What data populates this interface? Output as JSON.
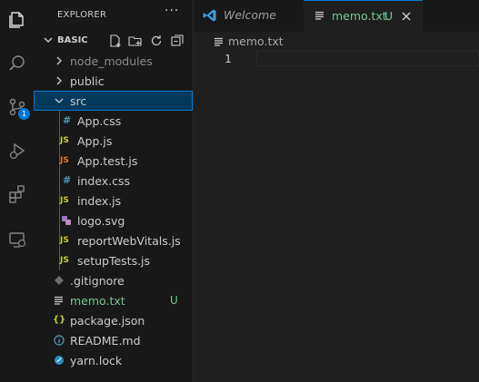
{
  "sidebar": {
    "title": "EXPLORER",
    "more_label": "···",
    "section": "BASIC",
    "items": [
      {
        "label": "node_modules"
      },
      {
        "label": "public"
      },
      {
        "label": "src"
      },
      {
        "label": "App.css",
        "icon": "#"
      },
      {
        "label": "App.js",
        "icon": "JS"
      },
      {
        "label": "App.test.js",
        "icon": "JS"
      },
      {
        "label": "index.css",
        "icon": "#"
      },
      {
        "label": "index.js",
        "icon": "JS"
      },
      {
        "label": "logo.svg"
      },
      {
        "label": "reportWebVitals.js",
        "icon": "JS"
      },
      {
        "label": "setupTests.js",
        "icon": "JS"
      },
      {
        "label": ".gitignore"
      },
      {
        "label": "memo.txt",
        "status": "U"
      },
      {
        "label": "package.json",
        "icon": "{}"
      },
      {
        "label": "README.md"
      },
      {
        "label": "yarn.lock"
      }
    ]
  },
  "activity": {
    "source_control_badge": "1"
  },
  "editor": {
    "tabs": [
      {
        "label": "Welcome"
      },
      {
        "label": "memo.txt",
        "status": "U"
      }
    ],
    "breadcrumb": "memo.txt",
    "line_number": "1"
  },
  "colors": {
    "accent": "#0078d4",
    "untracked": "#73c991",
    "css_icon": "#519aba",
    "js_icon": "#cbcb41",
    "test_icon": "#e37933",
    "svg_icon": "#a074c4"
  }
}
